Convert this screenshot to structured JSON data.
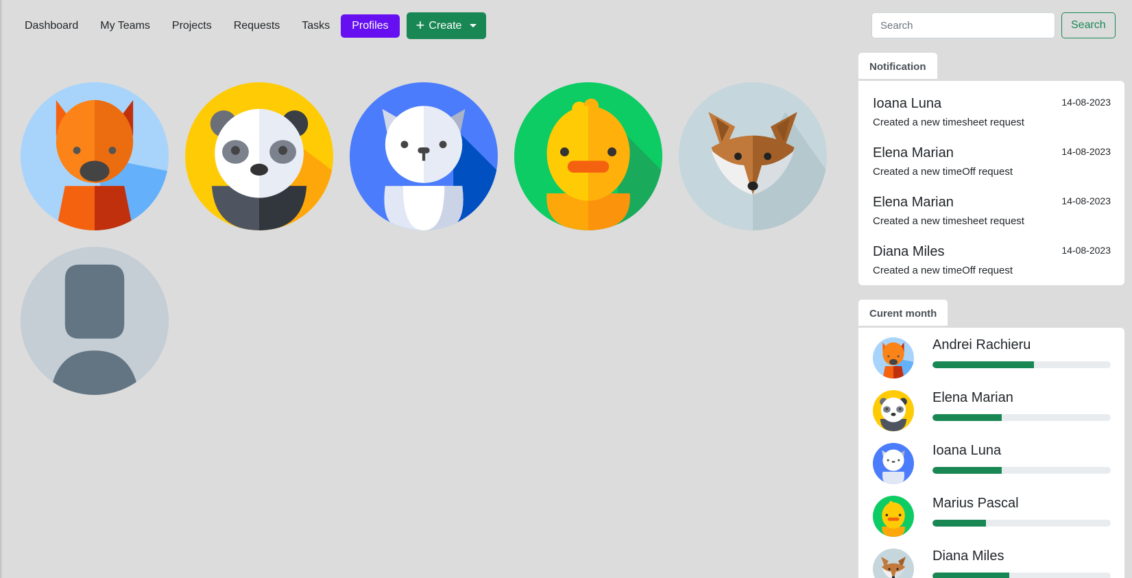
{
  "nav": {
    "items": [
      {
        "label": "Dashboard",
        "active": false
      },
      {
        "label": "My Teams",
        "active": false
      },
      {
        "label": "Projects",
        "active": false
      },
      {
        "label": "Requests",
        "active": false
      },
      {
        "label": "Tasks",
        "active": false
      },
      {
        "label": "Profiles",
        "active": true
      }
    ],
    "create_label": "Create"
  },
  "search": {
    "placeholder": "Search",
    "button_label": "Search"
  },
  "colors": {
    "accent_purple": "#6610f2",
    "success_green": "#198754",
    "background": "#dcdcdc"
  },
  "profiles": [
    {
      "avatar": "cat-icon",
      "bg": "#a8d4fb"
    },
    {
      "avatar": "panda-icon",
      "bg": "#ffcb05"
    },
    {
      "avatar": "wolf-icon",
      "bg": "#4a7cfb"
    },
    {
      "avatar": "chick-icon",
      "bg": "#0ccc63"
    },
    {
      "avatar": "fox-icon",
      "bg": "#c5d6dc"
    },
    {
      "avatar": "default-user-icon",
      "bg": "#c5cdd5"
    }
  ],
  "notification": {
    "title": "Notification",
    "items": [
      {
        "name": "Ioana Luna",
        "description": "Created a new timesheet request",
        "date": "14-08-2023"
      },
      {
        "name": "Elena Marian",
        "description": "Created a new timeOff request",
        "date": "14-08-2023"
      },
      {
        "name": "Elena Marian",
        "description": "Created a new timesheet request",
        "date": "14-08-2023"
      },
      {
        "name": "Diana Miles",
        "description": "Created a new timeOff request",
        "date": "14-08-2023"
      }
    ]
  },
  "current_month": {
    "title": "Curent month",
    "items": [
      {
        "name": "Andrei Rachieru",
        "avatar": "cat-icon",
        "progress": 57
      },
      {
        "name": "Elena Marian",
        "avatar": "panda-icon",
        "progress": 39
      },
      {
        "name": "Ioana Luna",
        "avatar": "wolf-icon",
        "progress": 39
      },
      {
        "name": "Marius Pascal",
        "avatar": "chick-icon",
        "progress": 30
      },
      {
        "name": "Diana Miles",
        "avatar": "fox-icon",
        "progress": 43
      }
    ]
  }
}
